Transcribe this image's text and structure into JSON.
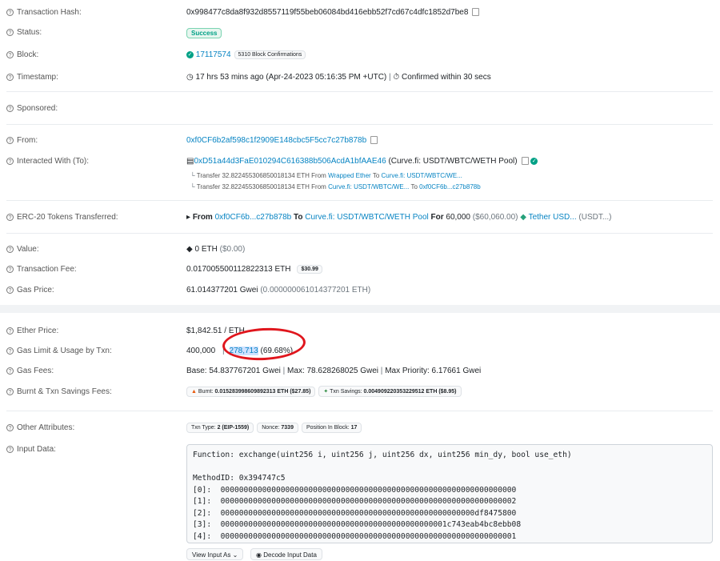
{
  "labels": {
    "tx_hash": "Transaction Hash:",
    "status": "Status:",
    "block": "Block:",
    "timestamp": "Timestamp:",
    "sponsored": "Sponsored:",
    "from": "From:",
    "interacted": "Interacted With (To):",
    "erc20": "ERC-20 Tokens Transferred:",
    "value": "Value:",
    "tx_fee": "Transaction Fee:",
    "gas_price": "Gas Price:",
    "ether_price": "Ether Price:",
    "gas_limit": "Gas Limit & Usage by Txn:",
    "gas_fees": "Gas Fees:",
    "burnt": "Burnt & Txn Savings Fees:",
    "other_attr": "Other Attributes:",
    "input_data": "Input Data:"
  },
  "tx_hash": "0x998477c8da8f932d8557119f55beb06084bd416ebb52f7cd67c4dfc1852d7be8",
  "status": "Success",
  "block": {
    "number": "17117574",
    "confirmations": "5310 Block Confirmations"
  },
  "timestamp": {
    "text": "17 hrs 53 mins ago (Apr-24-2023 05:16:35 PM +UTC)",
    "sep": "|",
    "confirmed": "Confirmed within 30 secs"
  },
  "from": "0xf0CF6b2af598c1f2909E148cbc5F5cc7c27b878b",
  "interacted": {
    "address": "0xD51a44d3FaE010294C616388b506AcdA1bfAAE46",
    "name": "(Curve.fi: USDT/WBTC/WETH Pool)",
    "transfers": [
      {
        "prefix": "Transfer",
        "amount": "32.822455306850018134 ETH",
        "from_word": "From",
        "from": "Wrapped Ether",
        "to_word": "To",
        "to": "Curve.fi: USDT/WBTC/WE..."
      },
      {
        "prefix": "Transfer",
        "amount": "32.822455306850018134 ETH",
        "from_word": "From",
        "from": "Curve.fi: USDT/WBTC/WE...",
        "to_word": "To",
        "to": "0xf0CF6b...c27b878b"
      }
    ]
  },
  "erc20": {
    "from_word": "From",
    "from": "0xf0CF6b...c27b878b",
    "to_word": "To",
    "to": "Curve.fi: USDT/WBTC/WETH Pool",
    "for_word": "For",
    "amount": "60,000",
    "usd": "($60,060.00)",
    "token": "Tether USD...",
    "token_sym": "(USDT...)"
  },
  "value": {
    "eth": "0 ETH",
    "usd": "($0.00)"
  },
  "tx_fee": {
    "eth": "0.017005500112822313 ETH",
    "usd": "$30.99"
  },
  "gas_price": {
    "gwei": "61.014377201 Gwei",
    "eth": "(0.000000061014377201 ETH)"
  },
  "ether_price": "$1,842.51 / ETH",
  "gas_limit": {
    "limit": "400,000",
    "sep": "|",
    "used": "278,713",
    "pct": "(69.68%)"
  },
  "gas_fees": {
    "base": "Base: 54.837767201 Gwei",
    "max": "Max: 78.628268025 Gwei",
    "priority": "Max Priority: 6.17661 Gwei",
    "sep": "|"
  },
  "burnt": {
    "burnt_label": "Burnt:",
    "burnt": "0.015283998609892313 ETH ($27.85)",
    "savings_label": "Txn Savings:",
    "savings": "0.004909220353229512 ETH ($8.95)"
  },
  "other_attr": {
    "txn_type_label": "Txn Type:",
    "txn_type": "2 (EIP-1559)",
    "nonce_label": "Nonce:",
    "nonce": "7339",
    "position_label": "Position In Block:",
    "position": "17"
  },
  "input_data": {
    "function": "Function: exchange(uint256 i, uint256 j, uint256 dx, uint256 min_dy, bool use_eth)",
    "blank": "",
    "method_id": "MethodID: 0x394747c5",
    "params": [
      "[0]:  0000000000000000000000000000000000000000000000000000000000000000",
      "[1]:  0000000000000000000000000000000000000000000000000000000000000002",
      "[2]:  0000000000000000000000000000000000000000000000000000000df8475800",
      "[3]:  0000000000000000000000000000000000000000000000001c743eab4bc8ebb08",
      "[4]:  0000000000000000000000000000000000000000000000000000000000000001"
    ]
  },
  "buttons": {
    "view_input": "View Input As",
    "decode": "Decode Input Data"
  },
  "colors": {
    "link": "#0784c3",
    "success": "#00a186",
    "annotation": "#e0161d"
  }
}
